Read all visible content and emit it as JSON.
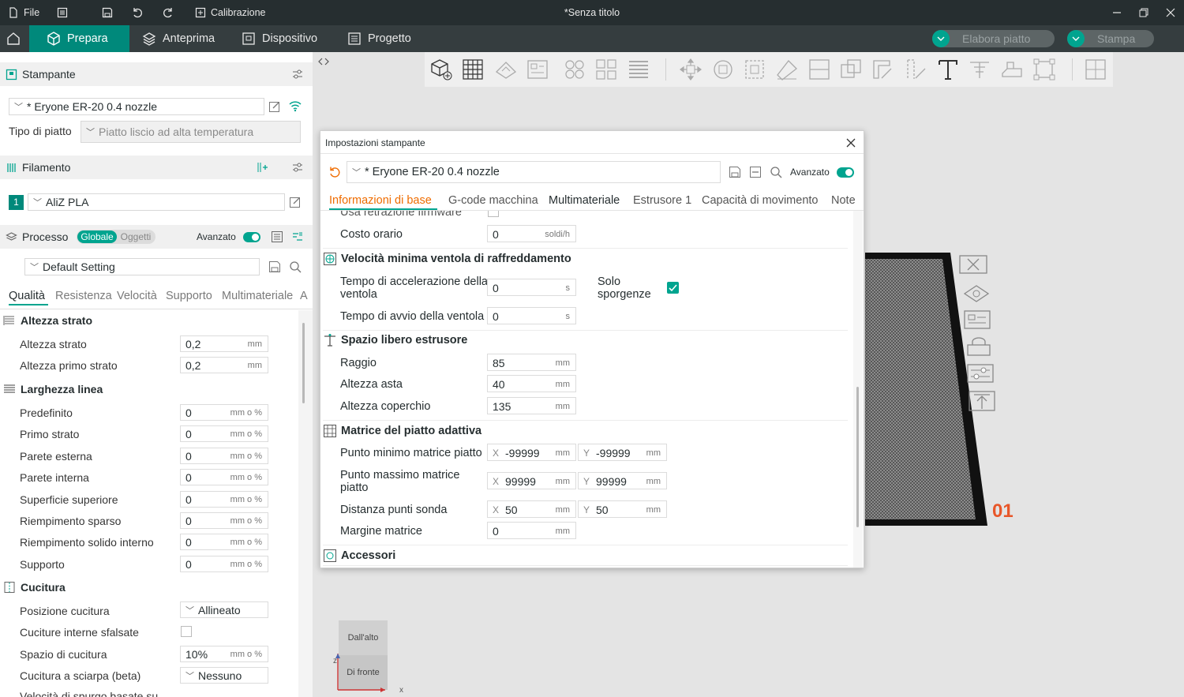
{
  "titlebar": {
    "file": "File",
    "calibration": "Calibrazione",
    "window_title": "*Senza titolo"
  },
  "nav": {
    "prepare": "Prepara",
    "preview": "Anteprima",
    "device": "Dispositivo",
    "project": "Progetto",
    "slice": "Elabora piatto",
    "print": "Stampa"
  },
  "printer": {
    "header": "Stampante",
    "selected": "* Eryone ER-20 0.4 nozzle",
    "bed_label": "Tipo di piatto",
    "bed_value": "Piatto liscio ad alta temperatura"
  },
  "filament": {
    "header": "Filamento",
    "index": "1",
    "selected": "AliZ PLA"
  },
  "process": {
    "header": "Processo",
    "global": "Globale",
    "objects": "Oggetti",
    "advanced": "Avanzato",
    "preset": "Default Setting",
    "tabs": [
      "Qualità",
      "Resistenza",
      "Velocità",
      "Supporto",
      "Multimateriale",
      "A"
    ]
  },
  "quality": {
    "layer_group": "Altezza strato",
    "layer_height": {
      "label": "Altezza strato",
      "value": "0,2",
      "unit": "mm"
    },
    "first_layer": {
      "label": "Altezza primo strato",
      "value": "0,2",
      "unit": "mm"
    },
    "width_group": "Larghezza linea",
    "widths": [
      {
        "label": "Predefinito",
        "value": "0",
        "unit": "mm o %"
      },
      {
        "label": "Primo strato",
        "value": "0",
        "unit": "mm o %"
      },
      {
        "label": "Parete esterna",
        "value": "0",
        "unit": "mm o %"
      },
      {
        "label": "Parete interna",
        "value": "0",
        "unit": "mm o %"
      },
      {
        "label": "Superficie superiore",
        "value": "0",
        "unit": "mm o %"
      },
      {
        "label": "Riempimento sparso",
        "value": "0",
        "unit": "mm o %"
      },
      {
        "label": "Riempimento solido interno",
        "value": "0",
        "unit": "mm o %"
      },
      {
        "label": "Supporto",
        "value": "0",
        "unit": "mm o %"
      }
    ],
    "seam_group": "Cucitura",
    "seam_position": {
      "label": "Posizione cucitura",
      "value": "Allineato"
    },
    "staggered": {
      "label": "Cuciture interne sfalsate"
    },
    "seam_gap": {
      "label": "Spazio di cucitura",
      "value": "10%",
      "unit": "mm o %"
    },
    "scarf": {
      "label": "Cucitura a sciarpa (beta)",
      "value": "Nessuno"
    },
    "cut_off": "Velocità di spurgo basate su"
  },
  "viewport": {
    "plate_number": "01",
    "view_top": "Dall'alto",
    "view_front": "Di fronte",
    "axis_z": "z",
    "axis_x": "x"
  },
  "dialog": {
    "title": "Impostazioni stampante",
    "preset": "* Eryone ER-20 0.4 nozzle",
    "advanced": "Avanzato",
    "tabs": [
      "Informazioni di base",
      "G-code macchina",
      "Multimateriale",
      "Estrusore 1",
      "Capacità di movimento",
      "Note"
    ],
    "cut_top": "Usa retrazione firmware",
    "hourly_cost": {
      "label": "Costo orario",
      "value": "0",
      "unit": "soldi/h"
    },
    "fan_group": "Velocità minima ventola di raffreddamento",
    "fan_accel": {
      "label": "Tempo di accelerazione della ventola",
      "value": "0",
      "unit": "s"
    },
    "overhang_only": "Solo sporgenze",
    "fan_kickstart": {
      "label": "Tempo di avvio della ventola",
      "value": "0",
      "unit": "s"
    },
    "clearance_group": "Spazio libero estrusore",
    "radius": {
      "label": "Raggio",
      "value": "85",
      "unit": "mm"
    },
    "rod_height": {
      "label": "Altezza asta",
      "value": "40",
      "unit": "mm"
    },
    "lid_height": {
      "label": "Altezza coperchio",
      "value": "135",
      "unit": "mm"
    },
    "mesh_group": "Matrice del piatto adattiva",
    "mesh_min": {
      "label": "Punto minimo matrice piatto",
      "x": "-99999",
      "y": "-99999",
      "unit": "mm"
    },
    "mesh_max": {
      "label": "Punto massimo matrice piatto",
      "x": "99999",
      "y": "99999",
      "unit": "mm"
    },
    "probe": {
      "label": "Distanza punti sonda",
      "x": "50",
      "y": "50",
      "unit": "mm"
    },
    "margin": {
      "label": "Margine matrice",
      "value": "0",
      "unit": "mm"
    },
    "accessories": "Accessori",
    "x_prefix": "X",
    "y_prefix": "Y"
  },
  "colors": {
    "accent": "#00a48f",
    "active_tab": "#ef6c00",
    "plate_number": "#e8572a",
    "dark": "#262e30"
  }
}
